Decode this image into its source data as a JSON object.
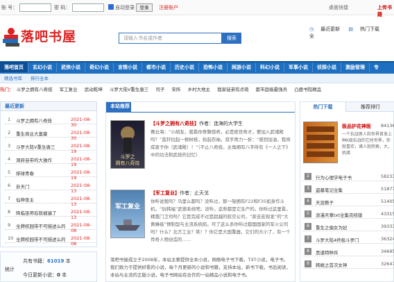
{
  "topbar": {
    "account_label": "账 号：",
    "password_label": "密 码：",
    "auto_login_label": "自动登录",
    "login_button": "登录",
    "register_link": "注册账户",
    "desktop_shortcut": "桌面快捷",
    "bookshelf_link": "上传书籍"
  },
  "logo": {
    "text": "落吧书屋"
  },
  "search": {
    "placeholder": "请输入书名或作者",
    "button": "搜索"
  },
  "header_links": [
    "最近更新",
    "热门下载",
    "全"
  ],
  "nav": [
    "落吧首页",
    "玄幻小说",
    "武侠小说",
    "奇幻小说",
    "言情小说",
    "都市小说",
    "历史小说",
    "恐怖小说",
    "网游小说",
    "科幻小说",
    "军事小说",
    "侦探小说",
    "激励管理",
    "专"
  ],
  "subnav": [
    "精选书库",
    "排行全本"
  ],
  "hot_label": "热门：",
  "hot_links": [
    "斗罗之拥有八奇技",
    "军工复业",
    "武动乾坤",
    "斗罗大陆V重生唐三",
    "司子",
    "宋所",
    "乡村大地主",
    "我家徒弟有点萌",
    "都市超级最强兵",
    "凸鹿书院精品"
  ],
  "left": {
    "title": "最近更新",
    "items": [
      {
        "num": "1",
        "title": "斗罗之拥有八奇技",
        "date": "2021-08-30"
      },
      {
        "num": "2",
        "title": "重生商业大富豪",
        "date": "2021-08-30"
      },
      {
        "num": "3",
        "title": "斗罗大陆V重生唐三",
        "date": "2021-08-19"
      },
      {
        "num": "4",
        "title": "洞府自带的大操作",
        "date": "2021-08-19"
      },
      {
        "num": "5",
        "title": "排球青春",
        "date": "2021-08-19"
      },
      {
        "num": "6",
        "title": "卦天门",
        "date": "2021-08-13"
      },
      {
        "num": "7",
        "title": "仙神圣主",
        "date": "2021-08-13"
      },
      {
        "num": "8",
        "title": "降临巫师后就被遍了",
        "date": "2021-08-13"
      },
      {
        "num": "9",
        "title": "全牌校园带不可描述么的",
        "date": "2021-08-08"
      },
      {
        "num": "10",
        "title": "全牌校园带不可描述么的",
        "date": "2021-08-08"
      }
    ]
  },
  "stats": {
    "label": "统计",
    "total_label": "共有书籍：",
    "total": "61019",
    "total_unit": "本",
    "today_label": "今日更新小说：",
    "today": "0",
    "today_unit": "本"
  },
  "center": {
    "title": "本站推荐",
    "books": [
      {
        "title": "斗罗之拥有八奇技",
        "author_label": "作者：",
        "author": "连海的大学生",
        "desc": "赛云海：“小胡友，我看你骨骼惊奇，必是绝世奇才，要加入武魂殿吗？”蓝轩拉起一根树枝，抬起衣袖，双手用力一折：“感到加油，我将成害子你（武魂殿）！”（不止八奇技，主角拥有八字所有《一人之下》中的功法和武技的记忆）"
      },
      {
        "title": "军工复业",
        "author_label": "作者：",
        "author": "止天戈",
        "desc": "你听说我吗？马里么都吗？没听过，那一架拥有F22和F35如身作斗机，“玩韩福”武德系统吧，没听，这些都是它生产的。你听过这里看，精靠门卫司吗？它是完成不过是超越的航空公司，“奔吉宏现发”的“大黄蜂级”预制型与主流系统航。可了这么多你听过都国国家的军火公司吗？什么？北方工业？笑！？你它是大国重器，它们的大小了，有一个传奇人物创造的……"
      }
    ],
    "about": "落吧书屋成立于2008年，本站主要提供全本小说，网络电子书下载，TXT小说，电子书，我们致力于提供好看的小说，每个月更新的小说和书籍，支持本站，新书下载，书后阅读，本站与主流的正版小说，电子书网站有合作的一站精品小说和电子书。"
  },
  "right": {
    "tab_active": "热门下载",
    "tab_other": "推荐排行",
    "feature": {
      "title": "极品护花神医",
      "count": "841363",
      "desc": "一个抗战男人和世界首发上种K级抗战的它时世界，你就喜欢，诸人就转换，大，机缘"
    },
    "ranks": [
      {
        "num": "2",
        "title": "行为心理学电子书",
        "count": "582337"
      },
      {
        "num": "3",
        "title": "盗墓笔记全集",
        "count": "518771"
      },
      {
        "num": "4",
        "title": "天涯教子",
        "count": "514053"
      },
      {
        "num": "5",
        "title": "浪漫天尊txt全集完结版",
        "count": "433157"
      },
      {
        "num": "6",
        "title": "重生之偏女为妃",
        "count": "393335"
      },
      {
        "num": "7",
        "title": "斗罗大陆4终极斗罗门",
        "count": "363245"
      },
      {
        "num": "8",
        "title": "黑道特种兵",
        "count": "346953"
      },
      {
        "num": "9",
        "title": "韩娱之首次女神",
        "count": "326472"
      }
    ]
  },
  "colors": {
    "brand_blue": "#1e6fc0",
    "brand_red": "#d22",
    "date_red": "#d22"
  },
  "icons": [
    "checkbox-icon",
    "books-logo-icon",
    "clock-icon",
    "download-icon"
  ]
}
